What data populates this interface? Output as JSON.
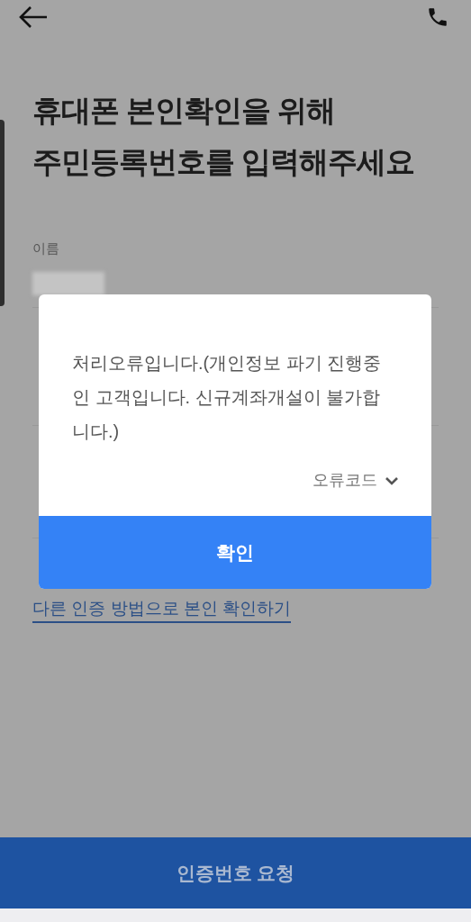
{
  "title_lines": [
    "휴대폰 본인확인을 위해",
    "주민등록번호를 입력해주세요"
  ],
  "name_field": {
    "label": "이름",
    "redacted": true
  },
  "alt_link": "다른 인증 방법으로 본인 확인하기",
  "submit_button": "인증번호 요청",
  "dialog": {
    "message": "처리오류입니다.(개인정보 파기 진행중인 고객입니다. 신규계좌개설이 불가합니다.)",
    "error_code_toggle": {
      "label": "오류코드",
      "expanded": false
    },
    "confirm_button": "확인"
  }
}
